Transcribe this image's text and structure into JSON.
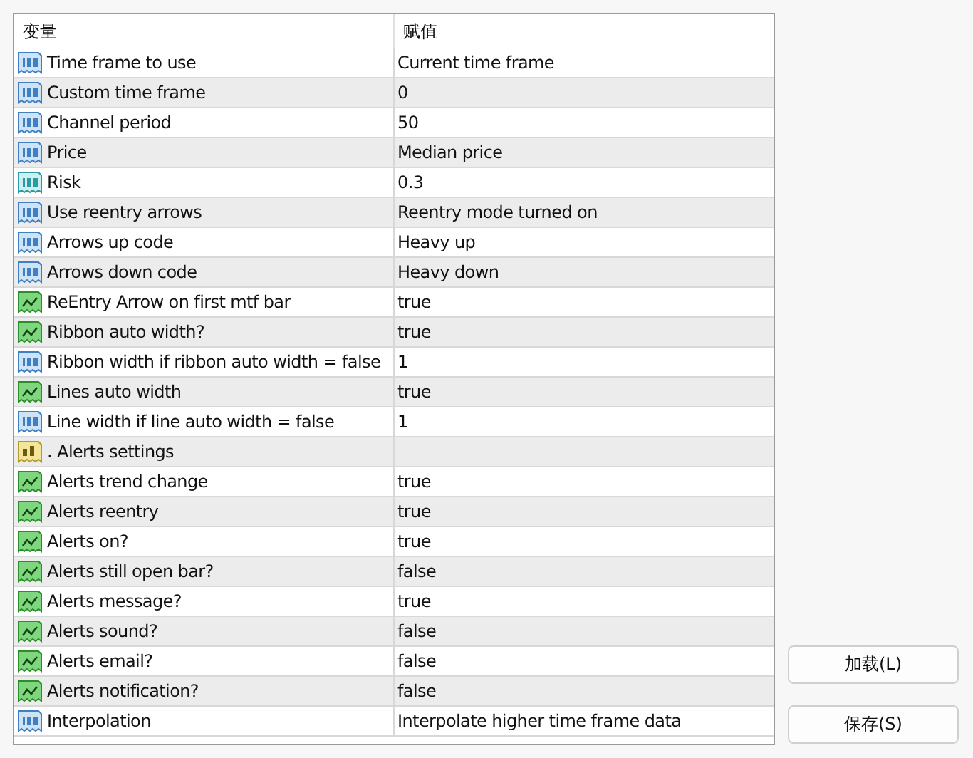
{
  "table": {
    "columns": [
      "变量",
      "赋值"
    ],
    "rows": [
      {
        "kind": "int",
        "name": "Time frame to use",
        "value": "Current time frame"
      },
      {
        "kind": "int",
        "name": "Custom time frame",
        "value": "0"
      },
      {
        "kind": "int",
        "name": "Channel period",
        "value": "50"
      },
      {
        "kind": "int",
        "name": "Price",
        "value": "Median price"
      },
      {
        "kind": "double",
        "name": "Risk",
        "value": "0.3"
      },
      {
        "kind": "int",
        "name": "Use reentry arrows",
        "value": "Reentry mode turned on"
      },
      {
        "kind": "int",
        "name": "Arrows up code",
        "value": "Heavy up"
      },
      {
        "kind": "int",
        "name": "Arrows down code",
        "value": "Heavy down"
      },
      {
        "kind": "bool",
        "name": "ReEntry Arrow on first mtf bar",
        "value": "true"
      },
      {
        "kind": "bool",
        "name": "Ribbon auto width?",
        "value": "true"
      },
      {
        "kind": "int",
        "name": "Ribbon width if ribbon auto width = false",
        "value": "1"
      },
      {
        "kind": "bool",
        "name": "Lines auto width",
        "value": "true"
      },
      {
        "kind": "int",
        "name": "Line width if line auto width = false",
        "value": "1"
      },
      {
        "kind": "string",
        "name": ".   Alerts settings"
      },
      {
        "kind": "bool",
        "name": "Alerts trend change",
        "value": "true"
      },
      {
        "kind": "bool",
        "name": "Alerts reentry",
        "value": "true"
      },
      {
        "kind": "bool",
        "name": "Alerts on?",
        "value": "true"
      },
      {
        "kind": "bool",
        "name": "Alerts still open bar?",
        "value": "false"
      },
      {
        "kind": "bool",
        "name": "Alerts message?",
        "value": "true"
      },
      {
        "kind": "bool",
        "name": "Alerts sound?",
        "value": "false"
      },
      {
        "kind": "bool",
        "name": "Alerts email?",
        "value": "false"
      },
      {
        "kind": "bool",
        "name": "Alerts notification?",
        "value": "false"
      },
      {
        "kind": "int",
        "name": "Interpolation",
        "value": "Interpolate higher time frame data"
      }
    ]
  },
  "buttons": [
    "加载(L)",
    "保存(S)"
  ]
}
